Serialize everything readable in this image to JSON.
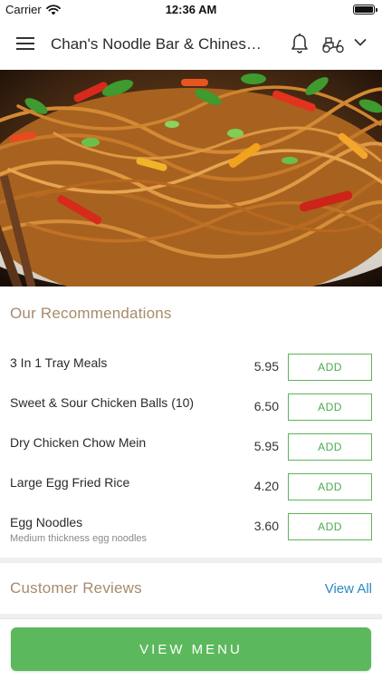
{
  "status_bar": {
    "carrier": "Carrier",
    "time": "12:36 AM",
    "wifi_icon": "wifi-icon",
    "battery_icon": "battery-icon"
  },
  "header": {
    "title": "Chan's Noodle Bar & Chinese Takeaway",
    "menu_icon": "hamburger-icon",
    "notification_icon": "bell-icon",
    "delivery_icon": "scooter-icon",
    "dropdown_icon": "chevron-down-icon"
  },
  "hero": {
    "image": "noodles-photo"
  },
  "recommendations": {
    "title": "Our Recommendations",
    "add_label": "ADD",
    "items": [
      {
        "name": "3 In 1 Tray Meals",
        "price": "5.95",
        "description": ""
      },
      {
        "name": "Sweet & Sour Chicken Balls (10)",
        "price": "6.50",
        "description": ""
      },
      {
        "name": "Dry Chicken Chow Mein",
        "price": "5.95",
        "description": ""
      },
      {
        "name": "Large Egg Fried Rice",
        "price": "4.20",
        "description": ""
      },
      {
        "name": "Egg Noodles",
        "price": "3.60",
        "description": "Medium thickness egg noodles"
      }
    ]
  },
  "reviews": {
    "title": "Customer Reviews",
    "view_all": "View All"
  },
  "footer": {
    "button_label": "VIEW MENU"
  },
  "colors": {
    "accent_green": "#5cb85c",
    "section_title": "#a78b6b",
    "link_blue": "#2b8ac0"
  }
}
